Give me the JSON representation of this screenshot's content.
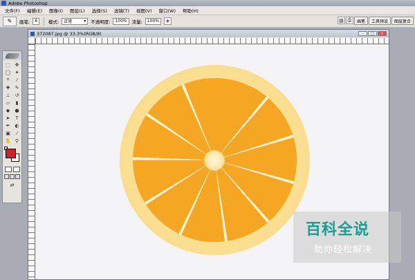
{
  "app": {
    "title": "Adobe Photoshop"
  },
  "menu": [
    "文件(F)",
    "编辑(E)",
    "图像(I)",
    "图层(L)",
    "选择(S)",
    "滤镜(T)",
    "视图(V)",
    "窗口(W)",
    "帮助(H)"
  ],
  "options": {
    "brush_label": "画笔:",
    "brush_size": "6",
    "mode_label": "模式:",
    "mode_value": "正常",
    "opacity_label": "不透明度:",
    "opacity_value": "100%",
    "flow_label": "流量:",
    "flow_value": "100%"
  },
  "palette_tabs": [
    "画笔",
    "工具预设",
    "图层复合"
  ],
  "document": {
    "title": "372087.jpg @ 33.3%(RGB/8)"
  },
  "toolbox": {
    "foreground_color": "#d11f22",
    "background_color": "#ffffff"
  },
  "watermark": {
    "title": "百科全说",
    "subtitle": "助你轻松解决"
  }
}
